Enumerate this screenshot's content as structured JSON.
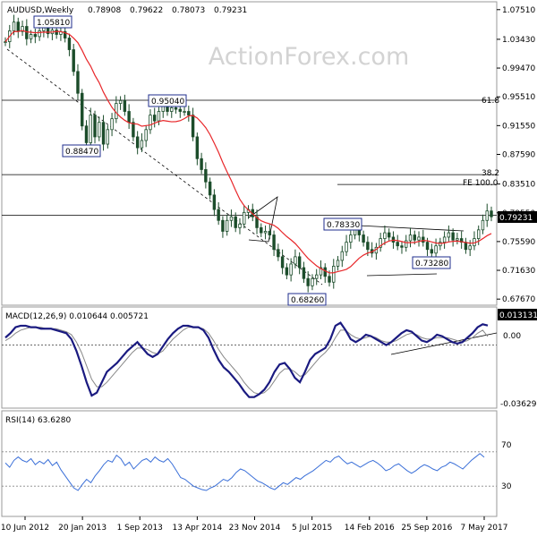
{
  "chart_data": [
    {
      "type": "candlestick",
      "title": "AUDUSD,Weekly",
      "ohlc_header": [
        "0.78908",
        "0.79622",
        "0.78073",
        "0.79231"
      ],
      "watermark": "ActionForex.com",
      "x_ticks": [
        "10 Jun 2012",
        "20 Jan 2013",
        "1 Sep 2013",
        "13 Apr 2014",
        "23 Nov 2014",
        "5 Jul 2015",
        "14 Feb 2016",
        "25 Sep 2016",
        "7 May 2017"
      ],
      "y_ticks": [
        "1.07510",
        "1.03430",
        "0.99470",
        "0.95510",
        "0.91550",
        "0.87590",
        "0.83510",
        "0.79550",
        "0.75590",
        "0.71630",
        "0.67670"
      ],
      "ylim": [
        0.672,
        1.081
      ],
      "last_price": "0.79231",
      "close_series": [
        1.031,
        1.046,
        1.058,
        1.045,
        1.052,
        1.035,
        1.041,
        1.038,
        1.046,
        1.05,
        1.042,
        1.047,
        1.041,
        1.045,
        1.036,
        1.02,
        0.99,
        0.96,
        0.915,
        0.892,
        0.93,
        0.9,
        0.92,
        0.89,
        0.91,
        0.925,
        0.946,
        0.95,
        0.935,
        0.92,
        0.9,
        0.885,
        0.895,
        0.91,
        0.93,
        0.922,
        0.935,
        0.942,
        0.935,
        0.94,
        0.938,
        0.935,
        0.935,
        0.93,
        0.9,
        0.87,
        0.855,
        0.838,
        0.82,
        0.8,
        0.785,
        0.77,
        0.785,
        0.79,
        0.775,
        0.78,
        0.796,
        0.8,
        0.79,
        0.775,
        0.768,
        0.77,
        0.765,
        0.745,
        0.735,
        0.72,
        0.71,
        0.725,
        0.735,
        0.72,
        0.705,
        0.695,
        0.705,
        0.71,
        0.72,
        0.708,
        0.7,
        0.722,
        0.73,
        0.742,
        0.755,
        0.765,
        0.775,
        0.765,
        0.755,
        0.745,
        0.74,
        0.748,
        0.76,
        0.768,
        0.762,
        0.755,
        0.75,
        0.748,
        0.757,
        0.765,
        0.758,
        0.762,
        0.755,
        0.745,
        0.74,
        0.75,
        0.755,
        0.762,
        0.768,
        0.758,
        0.76,
        0.755,
        0.745,
        0.75,
        0.76,
        0.772,
        0.785,
        0.798,
        0.79
      ],
      "series": [
        {
          "name": "SMA",
          "color": "#e8272a"
        }
      ],
      "levels": [
        {
          "label": "0.95040",
          "value": 0.9504
        },
        {
          "label": "0.88470",
          "value": 0.8847
        },
        {
          "label": "1.05810",
          "value": 1.0581
        },
        {
          "label": "0.78330",
          "value": 0.7833
        },
        {
          "label": "0.73280",
          "value": 0.7328
        },
        {
          "label": "0.68260",
          "value": 0.6826
        }
      ],
      "fib_labels": [
        {
          "label": "61.8",
          "value": 0.953
        },
        {
          "label": "38.2",
          "value": 0.848
        },
        {
          "label": "FE 100.0",
          "value": 0.8345
        }
      ]
    },
    {
      "type": "line",
      "title": "MACD(12,26,9) 0.010644 0.005721",
      "y_ticks": [
        "0.013131",
        "0.00",
        "-0.03629"
      ],
      "ylim": [
        -0.04,
        0.022
      ],
      "series": [
        {
          "name": "MACD",
          "color": "#1a1a80",
          "values": [
            0.005,
            0.008,
            0.012,
            0.013,
            0.013,
            0.012,
            0.012,
            0.011,
            0.011,
            0.011,
            0.01,
            0.009,
            0.008,
            0.004,
            -0.004,
            -0.014,
            -0.025,
            -0.034,
            -0.032,
            -0.025,
            -0.018,
            -0.015,
            -0.012,
            -0.008,
            -0.004,
            -0.001,
            0.002,
            -0.002,
            -0.006,
            -0.008,
            -0.006,
            -0.001,
            0.004,
            0.008,
            0.011,
            0.013,
            0.013,
            0.012,
            0.012,
            0.01,
            0.005,
            -0.003,
            -0.01,
            -0.015,
            -0.018,
            -0.022,
            -0.026,
            -0.031,
            -0.035,
            -0.035,
            -0.033,
            -0.03,
            -0.025,
            -0.018,
            -0.013,
            -0.012,
            -0.016,
            -0.022,
            -0.025,
            -0.018,
            -0.01,
            -0.006,
            -0.004,
            -0.002,
            0.004,
            0.013,
            0.015,
            0.01,
            0.004,
            0.002,
            0.004,
            0.007,
            0.006,
            0.004,
            0.002,
            0.0,
            0.002,
            0.005,
            0.008,
            0.01,
            0.009,
            0.006,
            0.003,
            0.002,
            0.004,
            0.007,
            0.006,
            0.004,
            0.002,
            0.001,
            0.002,
            0.005,
            0.008,
            0.012,
            0.014,
            0.013131
          ]
        },
        {
          "name": "Signal",
          "color": "#888888",
          "values": [
            0.003,
            0.005,
            0.008,
            0.01,
            0.011,
            0.012,
            0.012,
            0.012,
            0.011,
            0.011,
            0.011,
            0.01,
            0.009,
            0.007,
            0.002,
            -0.005,
            -0.014,
            -0.023,
            -0.028,
            -0.028,
            -0.025,
            -0.021,
            -0.017,
            -0.013,
            -0.009,
            -0.005,
            -0.002,
            -0.002,
            -0.003,
            -0.005,
            -0.006,
            -0.004,
            0.0,
            0.004,
            0.007,
            0.01,
            0.012,
            0.012,
            0.012,
            0.011,
            0.008,
            0.003,
            -0.003,
            -0.008,
            -0.012,
            -0.016,
            -0.02,
            -0.025,
            -0.029,
            -0.032,
            -0.033,
            -0.032,
            -0.029,
            -0.024,
            -0.019,
            -0.016,
            -0.016,
            -0.018,
            -0.021,
            -0.02,
            -0.016,
            -0.012,
            -0.008,
            -0.005,
            -0.001,
            0.005,
            0.01,
            0.01,
            0.007,
            0.005,
            0.004,
            0.005,
            0.006,
            0.005,
            0.003,
            0.002,
            0.002,
            0.003,
            0.005,
            0.007,
            0.008,
            0.007,
            0.005,
            0.004,
            0.004,
            0.005,
            0.005,
            0.005,
            0.004,
            0.003,
            0.002,
            0.003,
            0.005,
            0.008,
            0.01,
            0.005721
          ]
        }
      ]
    },
    {
      "type": "line",
      "title": "RSI(14) 63.6280",
      "y_ticks": [
        "70",
        "30"
      ],
      "ylim": [
        0,
        100
      ],
      "series": [
        {
          "name": "RSI",
          "color": "#3a6fd8",
          "values": [
            57,
            52,
            60,
            64,
            60,
            58,
            62,
            55,
            59,
            56,
            61,
            54,
            58,
            49,
            42,
            35,
            28,
            25,
            32,
            38,
            34,
            42,
            48,
            55,
            60,
            58,
            66,
            62,
            54,
            58,
            50,
            55,
            60,
            62,
            58,
            64,
            60,
            58,
            62,
            56,
            48,
            40,
            38,
            34,
            30,
            28,
            26,
            25,
            28,
            30,
            34,
            38,
            36,
            40,
            46,
            50,
            48,
            44,
            40,
            36,
            34,
            31,
            28,
            26,
            30,
            34,
            32,
            36,
            40,
            38,
            42,
            45,
            48,
            52,
            56,
            60,
            58,
            63,
            65,
            60,
            56,
            58,
            55,
            52,
            55,
            58,
            60,
            57,
            53,
            48,
            50,
            54,
            56,
            52,
            48,
            45,
            48,
            52,
            55,
            53,
            50,
            48,
            52,
            54,
            58,
            56,
            53,
            50,
            55,
            60,
            64,
            68,
            63.628
          ]
        }
      ]
    }
  ]
}
